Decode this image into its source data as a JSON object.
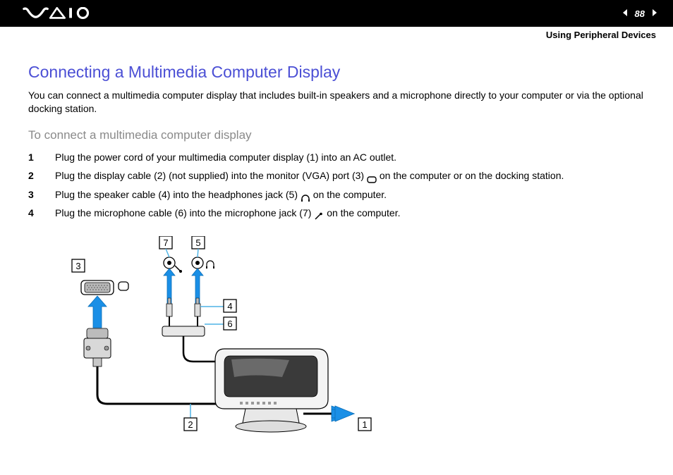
{
  "header": {
    "page_number": "88",
    "breadcrumb": "Using Peripheral Devices"
  },
  "title": "Connecting a Multimedia Computer Display",
  "intro": "You can connect a multimedia computer display that includes built-in speakers and a microphone directly to your computer or via the optional docking station.",
  "subtitle": "To connect a multimedia computer display",
  "steps": [
    {
      "text_a": "Plug the power cord of your multimedia computer display (1) into an AC outlet."
    },
    {
      "text_a": "Plug the display cable (2) (not supplied) into the monitor (VGA) port (3) ",
      "icon": "monitor",
      "text_b": " on the computer or on the docking station."
    },
    {
      "text_a": "Plug the speaker cable (4) into the headphones jack (5) ",
      "icon": "headphone",
      "text_b": " on the computer."
    },
    {
      "text_a": "Plug the microphone cable (6) into the microphone jack (7) ",
      "icon": "mic",
      "text_b": " on the computer."
    }
  ],
  "diagram": {
    "labels": {
      "l1": "1",
      "l2": "2",
      "l3": "3",
      "l4": "4",
      "l5": "5",
      "l6": "6",
      "l7": "7"
    }
  }
}
